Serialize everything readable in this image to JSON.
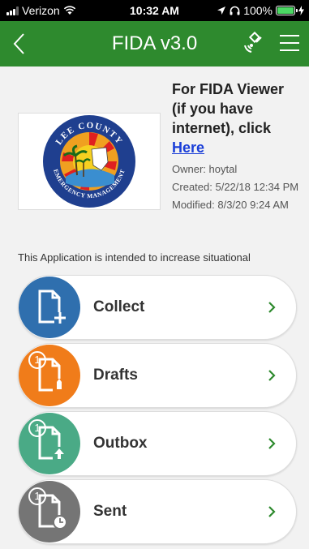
{
  "status_bar": {
    "carrier": "Verizon",
    "time": "10:32 AM",
    "battery": "100%",
    "battery_level": 1.0
  },
  "nav": {
    "title": "FIDA v3.0",
    "back_icon": "chevron-left-icon",
    "gps_icon": "satellite-icon",
    "menu_icon": "hamburger-menu-icon"
  },
  "app": {
    "logo_text_top": "LEE COUNTY",
    "logo_text_bottom": "EMERGENCY MANAGEMENT",
    "title": "For FIDA Viewer (if you have internet), click",
    "link": "Here",
    "owner": "Owner: hoytal",
    "created": "Created: 5/22/18 12:34 PM",
    "modified": "Modified: 8/3/20 9:24 AM",
    "description": "This Application is intended to increase situational"
  },
  "buttons": [
    {
      "label": "Collect",
      "color": "#2f6fae",
      "badge": ""
    },
    {
      "label": "Drafts",
      "color": "#f07c1a",
      "badge": "1"
    },
    {
      "label": "Outbox",
      "color": "#4aaa86",
      "badge": "1"
    },
    {
      "label": "Sent",
      "color": "#757575",
      "badge": "1"
    }
  ],
  "colors": {
    "nav_green": "#2e8a2e",
    "link_blue": "#1a3ed8",
    "chevron_green": "#2e8a2e"
  }
}
